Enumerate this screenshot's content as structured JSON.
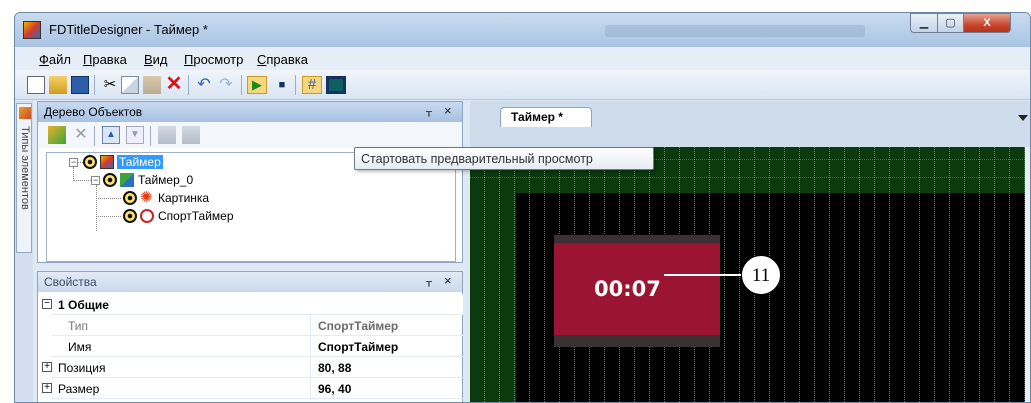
{
  "window": {
    "title": "FDTitleDesigner - Таймер *"
  },
  "window_controls": {
    "minimize": "▁",
    "maximize": "▢",
    "close": "X"
  },
  "menu": {
    "items": [
      "Файл",
      "Правка",
      "Вид",
      "Просмотр",
      "Справка"
    ]
  },
  "toolbar": {
    "icons": [
      "new-icon",
      "open-icon",
      "save-icon",
      "cut-icon",
      "copy-icon",
      "paste-icon",
      "delete-icon",
      "undo-icon",
      "redo-icon",
      "play-icon",
      "stop-icon",
      "grid-icon",
      "frame-icon"
    ]
  },
  "side_tab": {
    "label": "Типы элементов"
  },
  "tree_panel": {
    "title": "Дерево Объектов",
    "pin": "ᚁ",
    "close": "×",
    "nodes": [
      {
        "label": "Таймер",
        "selected": true
      },
      {
        "label": "Таймер_0"
      },
      {
        "label": "Картинка"
      },
      {
        "label": "СпортТаймер"
      }
    ]
  },
  "props_panel": {
    "title": "Свойства",
    "pin": "ᚁ",
    "close": "×",
    "group": "1 Общие",
    "rows": [
      {
        "name": "Тип",
        "value": "СпортТаймер"
      },
      {
        "name": "Имя",
        "value": "СпортТаймер"
      },
      {
        "name": "Позиция",
        "value": "80, 88"
      },
      {
        "name": "Размер",
        "value": "96, 40"
      }
    ]
  },
  "document": {
    "tab_label": "Таймер *",
    "timer_text": "00:07"
  },
  "tooltip": {
    "text": "Стартовать предварительный просмотр"
  },
  "callout": {
    "number": "11"
  },
  "colors": {
    "canvas_border": "#0b3a0e",
    "timer_fill": "#9b1432",
    "title_bar": "#a9c4e3"
  }
}
